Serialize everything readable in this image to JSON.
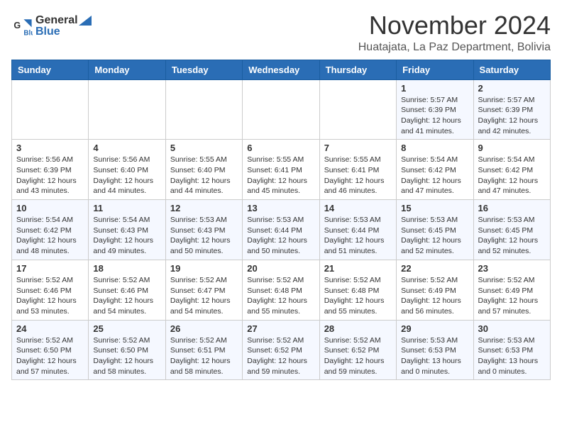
{
  "logo": {
    "general": "General",
    "blue": "Blue"
  },
  "title": "November 2024",
  "location": "Huatajata, La Paz Department, Bolivia",
  "days_of_week": [
    "Sunday",
    "Monday",
    "Tuesday",
    "Wednesday",
    "Thursday",
    "Friday",
    "Saturday"
  ],
  "weeks": [
    [
      {
        "day": "",
        "info": ""
      },
      {
        "day": "",
        "info": ""
      },
      {
        "day": "",
        "info": ""
      },
      {
        "day": "",
        "info": ""
      },
      {
        "day": "",
        "info": ""
      },
      {
        "day": "1",
        "info": "Sunrise: 5:57 AM\nSunset: 6:39 PM\nDaylight: 12 hours\nand 41 minutes."
      },
      {
        "day": "2",
        "info": "Sunrise: 5:57 AM\nSunset: 6:39 PM\nDaylight: 12 hours\nand 42 minutes."
      }
    ],
    [
      {
        "day": "3",
        "info": "Sunrise: 5:56 AM\nSunset: 6:39 PM\nDaylight: 12 hours\nand 43 minutes."
      },
      {
        "day": "4",
        "info": "Sunrise: 5:56 AM\nSunset: 6:40 PM\nDaylight: 12 hours\nand 44 minutes."
      },
      {
        "day": "5",
        "info": "Sunrise: 5:55 AM\nSunset: 6:40 PM\nDaylight: 12 hours\nand 44 minutes."
      },
      {
        "day": "6",
        "info": "Sunrise: 5:55 AM\nSunset: 6:41 PM\nDaylight: 12 hours\nand 45 minutes."
      },
      {
        "day": "7",
        "info": "Sunrise: 5:55 AM\nSunset: 6:41 PM\nDaylight: 12 hours\nand 46 minutes."
      },
      {
        "day": "8",
        "info": "Sunrise: 5:54 AM\nSunset: 6:42 PM\nDaylight: 12 hours\nand 47 minutes."
      },
      {
        "day": "9",
        "info": "Sunrise: 5:54 AM\nSunset: 6:42 PM\nDaylight: 12 hours\nand 47 minutes."
      }
    ],
    [
      {
        "day": "10",
        "info": "Sunrise: 5:54 AM\nSunset: 6:42 PM\nDaylight: 12 hours\nand 48 minutes."
      },
      {
        "day": "11",
        "info": "Sunrise: 5:54 AM\nSunset: 6:43 PM\nDaylight: 12 hours\nand 49 minutes."
      },
      {
        "day": "12",
        "info": "Sunrise: 5:53 AM\nSunset: 6:43 PM\nDaylight: 12 hours\nand 50 minutes."
      },
      {
        "day": "13",
        "info": "Sunrise: 5:53 AM\nSunset: 6:44 PM\nDaylight: 12 hours\nand 50 minutes."
      },
      {
        "day": "14",
        "info": "Sunrise: 5:53 AM\nSunset: 6:44 PM\nDaylight: 12 hours\nand 51 minutes."
      },
      {
        "day": "15",
        "info": "Sunrise: 5:53 AM\nSunset: 6:45 PM\nDaylight: 12 hours\nand 52 minutes."
      },
      {
        "day": "16",
        "info": "Sunrise: 5:53 AM\nSunset: 6:45 PM\nDaylight: 12 hours\nand 52 minutes."
      }
    ],
    [
      {
        "day": "17",
        "info": "Sunrise: 5:52 AM\nSunset: 6:46 PM\nDaylight: 12 hours\nand 53 minutes."
      },
      {
        "day": "18",
        "info": "Sunrise: 5:52 AM\nSunset: 6:46 PM\nDaylight: 12 hours\nand 54 minutes."
      },
      {
        "day": "19",
        "info": "Sunrise: 5:52 AM\nSunset: 6:47 PM\nDaylight: 12 hours\nand 54 minutes."
      },
      {
        "day": "20",
        "info": "Sunrise: 5:52 AM\nSunset: 6:48 PM\nDaylight: 12 hours\nand 55 minutes."
      },
      {
        "day": "21",
        "info": "Sunrise: 5:52 AM\nSunset: 6:48 PM\nDaylight: 12 hours\nand 55 minutes."
      },
      {
        "day": "22",
        "info": "Sunrise: 5:52 AM\nSunset: 6:49 PM\nDaylight: 12 hours\nand 56 minutes."
      },
      {
        "day": "23",
        "info": "Sunrise: 5:52 AM\nSunset: 6:49 PM\nDaylight: 12 hours\nand 57 minutes."
      }
    ],
    [
      {
        "day": "24",
        "info": "Sunrise: 5:52 AM\nSunset: 6:50 PM\nDaylight: 12 hours\nand 57 minutes."
      },
      {
        "day": "25",
        "info": "Sunrise: 5:52 AM\nSunset: 6:50 PM\nDaylight: 12 hours\nand 58 minutes."
      },
      {
        "day": "26",
        "info": "Sunrise: 5:52 AM\nSunset: 6:51 PM\nDaylight: 12 hours\nand 58 minutes."
      },
      {
        "day": "27",
        "info": "Sunrise: 5:52 AM\nSunset: 6:52 PM\nDaylight: 12 hours\nand 59 minutes."
      },
      {
        "day": "28",
        "info": "Sunrise: 5:52 AM\nSunset: 6:52 PM\nDaylight: 12 hours\nand 59 minutes."
      },
      {
        "day": "29",
        "info": "Sunrise: 5:53 AM\nSunset: 6:53 PM\nDaylight: 13 hours\nand 0 minutes."
      },
      {
        "day": "30",
        "info": "Sunrise: 5:53 AM\nSunset: 6:53 PM\nDaylight: 13 hours\nand 0 minutes."
      }
    ]
  ]
}
